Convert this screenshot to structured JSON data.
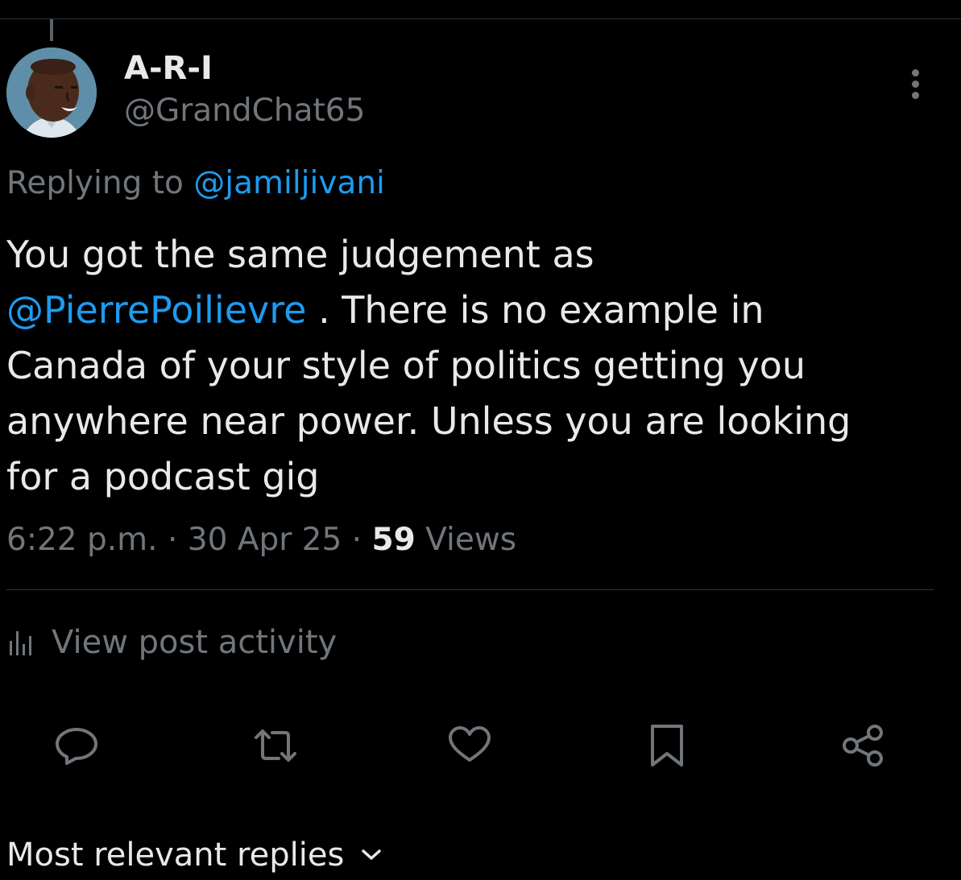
{
  "post": {
    "author": {
      "display_name": "A-R-I",
      "handle": "@GrandChat65"
    },
    "replying_to_prefix": "Replying to",
    "replying_to_handle": "@jamiljivani",
    "text_lines": [
      "You got the same judgement as",
      "@PierrePoilievre",
      ". There is no example in",
      "Canada of your style of politics getting you",
      "anywhere near power. Unless you are looking",
      "for a podcast gig"
    ],
    "time": "6:22 p.m.",
    "date": "30 Apr 25",
    "separator": "·",
    "views_count": "59",
    "views_label": "Views"
  },
  "activity": {
    "label": "View post activity",
    "icon": "bar-chart-icon"
  },
  "actions": {
    "reply_icon": "reply-icon",
    "repost_icon": "repost-icon",
    "like_icon": "heart-icon",
    "bookmark_icon": "bookmark-icon",
    "share_icon": "share-icon"
  },
  "replies_sort": {
    "label": "Most relevant replies",
    "icon": "chevron-down-icon"
  },
  "colors": {
    "background": "#000000",
    "text": "#e7e9ea",
    "secondary": "#71767b",
    "link": "#1d9bf0",
    "border": "#2f3336"
  }
}
